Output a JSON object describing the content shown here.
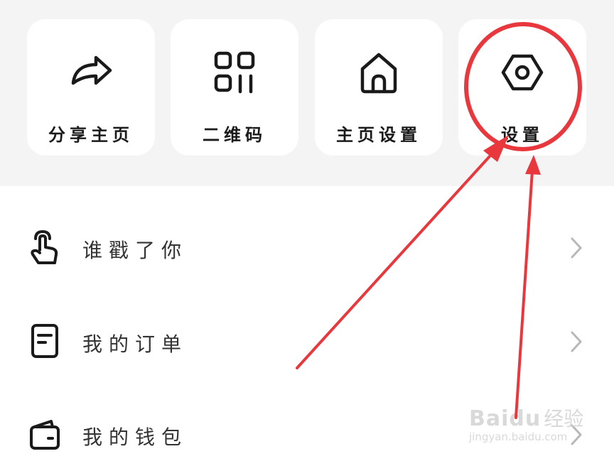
{
  "quick_actions": [
    {
      "label": "分享主页",
      "icon": "share-arrow-icon"
    },
    {
      "label": "二维码",
      "icon": "qr-code-icon"
    },
    {
      "label": "主页设置",
      "icon": "home-icon"
    },
    {
      "label": "设置",
      "icon": "settings-hexagon-icon"
    }
  ],
  "menu_items": [
    {
      "label": "谁戳了你",
      "icon": "tap-hand-icon"
    },
    {
      "label": "我的订单",
      "icon": "order-document-icon"
    },
    {
      "label": "我的钱包",
      "icon": "wallet-icon"
    }
  ],
  "watermark": {
    "brand": "Baidu",
    "brand_cn": "经验",
    "url": "jingyan.baidu.com"
  },
  "colors": {
    "annotation": "#e8383d",
    "background_top": "#f4f4f4",
    "card": "#ffffff"
  }
}
